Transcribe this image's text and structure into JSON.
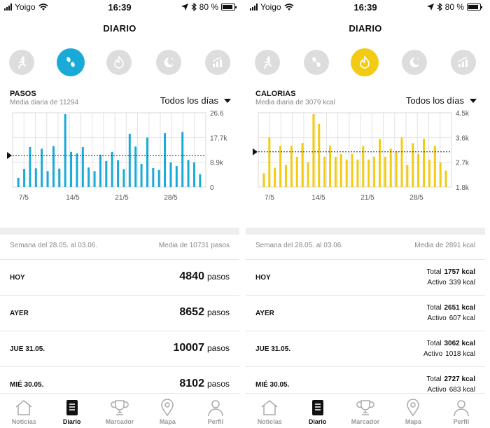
{
  "screens": [
    {
      "status": {
        "carrier": "Yoigo",
        "time": "16:39",
        "battery": "80 %"
      },
      "title": "DIARIO",
      "modes": [
        {
          "icon": "running-icon",
          "active": false
        },
        {
          "icon": "footsteps-icon",
          "active": true
        },
        {
          "icon": "flame-icon",
          "active": false
        },
        {
          "icon": "moon-icon",
          "active": false
        },
        {
          "icon": "trend-icon",
          "active": false
        }
      ],
      "accent": "#1aaad8",
      "metric": {
        "title": "PASOS",
        "subtitle": "Media diaria de 11294"
      },
      "filter_label": "Todos los días",
      "chart_data": {
        "type": "bar",
        "x_labels": [
          "7/5",
          "14/5",
          "21/5",
          "28/5"
        ],
        "y_ticks": [
          "26.6",
          "17.7k",
          "8.9k",
          "0"
        ],
        "ylim": [
          0,
          26600
        ],
        "average": 11294,
        "values": [
          3300,
          6500,
          14300,
          6700,
          13700,
          5700,
          14700,
          6600,
          26100,
          12600,
          12000,
          14300,
          7000,
          5700,
          11600,
          9300,
          12600,
          9600,
          6400,
          19100,
          14500,
          8300,
          17700,
          6800,
          6100,
          19300,
          8800,
          7500,
          19700,
          9700,
          8800,
          4600
        ]
      },
      "week": {
        "range": "Semana del 28.05. al 03.06.",
        "average": "Media de 10731 pasos"
      },
      "rows": [
        {
          "day": "HOY",
          "value": "4840",
          "unit": "pasos"
        },
        {
          "day": "AYER",
          "value": "8652",
          "unit": "pasos"
        },
        {
          "day": "JUE 31.05.",
          "value": "10007",
          "unit": "pasos"
        },
        {
          "day": "MIÉ 30.05.",
          "value": "8102",
          "unit": "pasos"
        }
      ],
      "tabs": [
        {
          "label": "Noticias",
          "icon": "house-icon",
          "active": false
        },
        {
          "label": "Diario",
          "icon": "journal-icon",
          "active": true
        },
        {
          "label": "Marcador",
          "icon": "trophy-icon",
          "active": false
        },
        {
          "label": "Mapa",
          "icon": "map-pin-icon",
          "active": false
        },
        {
          "label": "Perfil",
          "icon": "person-icon",
          "active": false
        }
      ]
    },
    {
      "status": {
        "carrier": "Yoigo",
        "time": "16:39",
        "battery": "80 %"
      },
      "title": "DIARIO",
      "modes": [
        {
          "icon": "running-icon",
          "active": false
        },
        {
          "icon": "footsteps-icon",
          "active": false
        },
        {
          "icon": "flame-icon",
          "active": true
        },
        {
          "icon": "moon-icon",
          "active": false
        },
        {
          "icon": "trend-icon",
          "active": false
        }
      ],
      "accent": "#f2cc14",
      "metric": {
        "title": "CALORIAS",
        "subtitle": "Media diaria de 3079 kcal"
      },
      "filter_label": "Todos los días",
      "chart_data": {
        "type": "bar",
        "x_labels": [
          "7/5",
          "14/5",
          "21/5",
          "28/5"
        ],
        "y_ticks": [
          "4.5k",
          "3.6k",
          "2.7k",
          "1.8k"
        ],
        "ylim": [
          1800,
          4500
        ],
        "average": 3079,
        "values": [
          2300,
          3600,
          2500,
          3300,
          2600,
          3300,
          2900,
          3400,
          2700,
          4450,
          4100,
          2900,
          3300,
          2900,
          3000,
          2800,
          3000,
          2800,
          3300,
          2800,
          2900,
          3550,
          2900,
          3200,
          3100,
          3600,
          2600,
          3400,
          3000,
          3550,
          2800,
          3300,
          2700,
          2400
        ]
      },
      "week": {
        "range": "Semana del 28.05. al 03.06.",
        "average": "Media de 2891 kcal"
      },
      "rows": [
        {
          "day": "HOY",
          "total_label": "Total",
          "total": "1757",
          "active_label": "Activo",
          "active": "339",
          "unit": "kcal"
        },
        {
          "day": "AYER",
          "total_label": "Total",
          "total": "2651",
          "active_label": "Activo",
          "active": "607",
          "unit": "kcal"
        },
        {
          "day": "JUE 31.05.",
          "total_label": "Total",
          "total": "3062",
          "active_label": "Activo",
          "active": "1018",
          "unit": "kcal"
        },
        {
          "day": "MIÉ 30.05.",
          "total_label": "Total",
          "total": "2727",
          "active_label": "Activo",
          "active": "683",
          "unit": "kcal"
        }
      ],
      "tabs": [
        {
          "label": "Noticias",
          "icon": "house-icon",
          "active": false
        },
        {
          "label": "Diario",
          "icon": "journal-icon",
          "active": true
        },
        {
          "label": "Marcador",
          "icon": "trophy-icon",
          "active": false
        },
        {
          "label": "Mapa",
          "icon": "map-pin-icon",
          "active": false
        },
        {
          "label": "Perfil",
          "icon": "person-icon",
          "active": false
        }
      ]
    }
  ]
}
